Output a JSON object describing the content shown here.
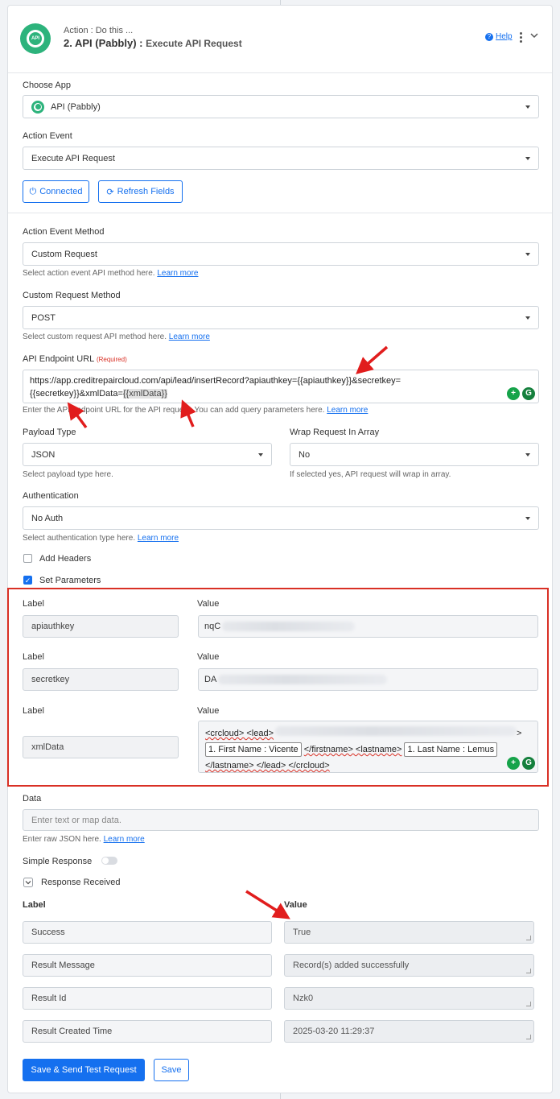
{
  "header": {
    "subtitle": "Action : Do this ...",
    "title": "2. API (Pabbly) :",
    "event": "Execute API Request",
    "icon_text": "API",
    "help_label": "Help"
  },
  "choose_app": {
    "label": "Choose App",
    "value": "API (Pabbly)"
  },
  "action_event": {
    "label": "Action Event",
    "value": "Execute API Request"
  },
  "buttons": {
    "connected": "Connected",
    "refresh": "Refresh Fields",
    "save_send": "Save & Send Test Request",
    "save": "Save"
  },
  "method": {
    "label": "Action Event Method",
    "value": "Custom Request",
    "hint": "Select action event API method here.",
    "learn": "Learn more"
  },
  "custom_method": {
    "label": "Custom Request Method",
    "value": "POST",
    "hint": "Select custom request API method here.",
    "learn": "Learn more"
  },
  "endpoint": {
    "label": "API Endpoint URL",
    "required": "(Required)",
    "line1": "https://app.creditrepaircloud.com/api/lead/insertRecord?apiauthkey={{apiauthkey}}&secretkey=",
    "line2_a": "{{secretkey}}&xmlData=",
    "line2_token": "{{xmlData}}",
    "hint": "Enter the API endpoint URL for the API request. You can add query parameters here.",
    "learn": "Learn more"
  },
  "payload": {
    "label": "Payload Type",
    "value": "JSON",
    "hint": "Select payload type here."
  },
  "wrap": {
    "label": "Wrap Request In Array",
    "value": "No",
    "hint": "If selected yes, API request will wrap in array."
  },
  "auth": {
    "label": "Authentication",
    "value": "No Auth",
    "hint": "Select authentication type here.",
    "learn": "Learn more"
  },
  "add_headers": "Add Headers",
  "set_params": "Set Parameters",
  "params": {
    "label_head": "Label",
    "value_head": "Value",
    "rows": [
      {
        "label": "apiauthkey",
        "value": "nqC"
      },
      {
        "label": "secretkey",
        "value": "DA"
      },
      {
        "label": "xmlData"
      }
    ],
    "xml": {
      "p1": "<crcloud> <lead>",
      "p2": ">",
      "pill1": "1. First Name : Vicente",
      "p3": "</firstname> <lastname>",
      "pill2": "1. Last Name : Lemus",
      "p4": "</lastname> </lead> </crcloud>"
    }
  },
  "data": {
    "label": "Data",
    "placeholder": "Enter text or map data.",
    "hint": "Enter raw JSON here.",
    "learn": "Learn more"
  },
  "simple_response": "Simple Response",
  "response_received": "Response Received",
  "response": {
    "label_head": "Label",
    "value_head": "Value",
    "rows": [
      {
        "label": "Success",
        "value": "True"
      },
      {
        "label": "Result Message",
        "value": "Record(s) added successfully"
      },
      {
        "label": "Result Id",
        "value": "Nzk0"
      },
      {
        "label": "Result Created Time",
        "value": "2025-03-20 11:29:37"
      }
    ]
  },
  "colors": {
    "accent": "#1570ef",
    "highlight": "#d93025",
    "brand": "#2db37c"
  }
}
